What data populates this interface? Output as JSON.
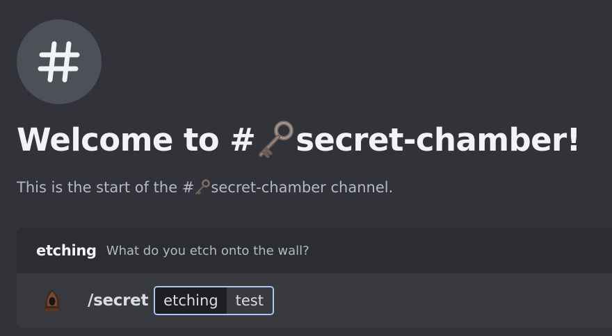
{
  "welcome": {
    "title_prefix": "Welcome to #",
    "title_channel": "secret-chamber!",
    "subtitle_prefix": "This is the start of the #",
    "subtitle_channel": "secret-chamber channel."
  },
  "icons": {
    "channel": "hashtag-icon",
    "channel_emoji": "old-key-icon",
    "app_avatar": "hooded-figure-avatar"
  },
  "command_preview": {
    "option_name": "etching",
    "option_description": "What do you etch onto the wall?",
    "command": "/secret",
    "option_key": "etching",
    "option_value": "test"
  },
  "colors": {
    "background": "#313338",
    "header_bar": "#2b2d31",
    "input_bg": "#383a40",
    "focus_outline": "#a8c7fa",
    "icon_circle": "#4e5058"
  }
}
